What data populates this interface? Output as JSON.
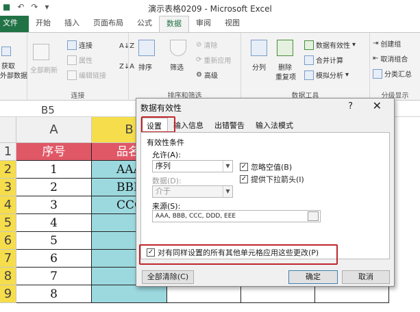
{
  "window": {
    "title": "演示表格0209 - Microsoft Excel"
  },
  "tabs": [
    {
      "label": "文件"
    },
    {
      "label": "开始"
    },
    {
      "label": "插入"
    },
    {
      "label": "页面布局"
    },
    {
      "label": "公式"
    },
    {
      "label": "数据"
    },
    {
      "label": "审阅"
    },
    {
      "label": "视图"
    }
  ],
  "ribbon": {
    "get_external": "获取\n外部数据",
    "get_external_l1": "获取",
    "get_external_l2": "外部数据",
    "refresh_all": "全部刷新",
    "connections": "连接",
    "properties": "属性",
    "edit_links": "编辑链接",
    "connections_group": "连接",
    "sort": "排序",
    "filter": "筛选",
    "clear": "清除",
    "reapply": "重新应用",
    "advanced": "高级",
    "sort_filter_group": "排序和筛选",
    "text_to_columns": "分列",
    "remove": "删除",
    "remove_dup": "重复项",
    "data_validation": "数据有效性",
    "consolidate": "合并计算",
    "what_if": "模拟分析",
    "data_tools_group": "数据工具",
    "group": "创建组",
    "ungroup": "取消组合",
    "subtotal": "分类汇总",
    "outline_group": "分级显示"
  },
  "namebox": "B5",
  "columns": [
    "A",
    "B"
  ],
  "rows": [
    "1",
    "2",
    "3",
    "4",
    "5",
    "6",
    "7",
    "8",
    "9"
  ],
  "cells": {
    "a": [
      "序号",
      "1",
      "2",
      "3",
      "4",
      "5",
      "6",
      "7",
      "8"
    ],
    "b": [
      "品名",
      "AAA",
      "BBB",
      "CCC",
      "",
      "",
      "",
      "",
      ""
    ]
  },
  "dialog": {
    "title": "数据有效性",
    "help": "?",
    "close": "✕",
    "tabs": [
      "设置",
      "输入信息",
      "出错警告",
      "输入法模式"
    ],
    "section": "有效性条件",
    "allow_label": "允许(A):",
    "allow_value": "序列",
    "data_label": "数据(D):",
    "data_value": "介于",
    "ignore_blank": "忽略空值(B)",
    "dropdown": "提供下拉箭头(I)",
    "source_label": "来源(S):",
    "source_value": "AAA, BBB, CCC, DDD, EEE",
    "apply_all": "对有同样设置的所有其他单元格应用这些更改(P)",
    "clear_all": "全部清除(C)",
    "ok": "确定",
    "cancel": "取消",
    "check_mark": "✓"
  },
  "colors": {
    "accent": "#217346",
    "header_fill": "#e05866",
    "col_b_fill": "#9cd9df",
    "row_sel": "#f6dd4b",
    "highlight": "#c0262c"
  }
}
